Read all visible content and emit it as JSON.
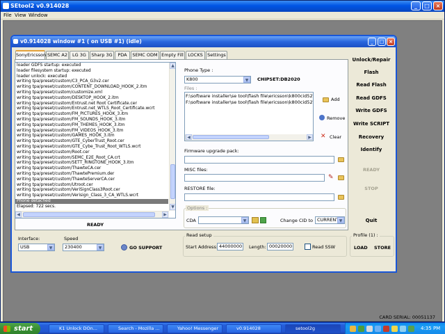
{
  "outer_window": {
    "title": "SEtool2 v0.914028"
  },
  "menubar": [
    "File",
    "View",
    "Window"
  ],
  "inner_window": {
    "title": "v0.914028 window #1 ( on USB #1) (idle)"
  },
  "tabs": [
    "SonyEricsson",
    "SEMC A2",
    "LG 3G",
    "Sharp 3G",
    "PDA",
    "SEMC ODM",
    "Empty Fill",
    "LOCKS",
    "Settings"
  ],
  "log": [
    "loader GDFS startup: executed",
    "loader filesystem startup: executed",
    "loader unlock: executed",
    "writing tpa/preset/custom/C3_PCA_G3v2.cer",
    "writing tpa/preset/custom/CONTENT_DOWNLOAD_HOOK_2.itm",
    "writing tpa/preset/custom/customize.xml",
    "writing tpa/preset/custom/DESKTOP_HOOK_2.itm",
    "writing tpa/preset/custom/Entrust.net Root Certificate.cer",
    "writing tpa/preset/custom/Entrust.net_WTLS_Root_Certificate.wcrt",
    "writing tpa/preset/custom/FM_PICTURES_HOOK_3.itm",
    "writing tpa/preset/custom/FM_SOUNDS_HOOK_3.itm",
    "writing tpa/preset/custom/FM_THEMES_HOOK_3.itm",
    "writing tpa/preset/custom/FM_VIDEOS_HOOK_3.itm",
    "writing tpa/preset/custom/GAMES_HOOK_3.itm",
    "writing tpa/preset/custom/GTE_CyberTrust_Root.cer",
    "writing tpa/preset/custom/GTE_Cybe_Trust_Root_WTLS.wcrt",
    "writing tpa/preset/custom/Root.cer",
    "writing tpa/preset/custom/SEMC_E2E_Root_CA.crt",
    "writing tpa/preset/custom/SETT_RINGTONE_HOOK_3.itm",
    "writing tpa/preset/custom/ThawteCA.cer",
    "writing tpa/preset/custom/ThawtePremium.der",
    "writing tpa/preset/custom/ThawteServerCA.cer",
    "writing tpa/preset/custom/Utroot.cer",
    "writing tpa/preset/custom/VeriSignClass3Root.cer",
    "writing tpa/preset/custom/Verisign_Class_3_CA_WTLS.wcrt",
    "Phone detached",
    "Elapsed: 722 secs."
  ],
  "status_left": "READY",
  "phone_type": {
    "label": "Phone Type :",
    "value": "K800",
    "chipset": "CHIPSET:DB2020"
  },
  "files": {
    "label": "Files :",
    "items": [
      "F:\\software installer\\se tool\\flash file\\ericsson\\k800cid52\\R1",
      "F:\\software installer\\se tool\\flash file\\ericsson\\k800cid52\\R1"
    ],
    "add": "Add",
    "remove": "Remove",
    "clear": "Clear"
  },
  "firmware": {
    "label": "Firmware upgrade pack:",
    "value": ""
  },
  "misc": {
    "label": "MISC files:",
    "value": ""
  },
  "restore": {
    "label": "RESTORE file:",
    "value": ""
  },
  "options": {
    "label": "Options :",
    "cda_label": "CDA",
    "cda_value": "",
    "change_cid_label": "Change CID to",
    "change_cid_value": "CURRENT"
  },
  "right_buttons": [
    "Unlock/Repair",
    "Flash",
    "Read Flash",
    "Read GDFS",
    "Write GDFS",
    "Write SCRIPT",
    "Recovery",
    "Identify",
    "READY",
    "STOP",
    "Quit"
  ],
  "interface": {
    "label": "Interface:",
    "value": "USB"
  },
  "speed": {
    "label": "Speed",
    "value": "230400"
  },
  "go_support": "GO SUPPORT",
  "read_setup": {
    "label": "Read setup",
    "start_label": "Start Address:",
    "start_value": "44000000",
    "length_label": "Length:",
    "length_value": "00020000",
    "ssw_label": "Read SSW"
  },
  "profile": {
    "label": "Profile (1) :",
    "load": "LOAD",
    "store": "STORE"
  },
  "card_serial": "CARD SERIAL: 00051137",
  "taskbar": {
    "start": "start",
    "tasks": [
      "K1 Unlock DOn...",
      "Search - Mozilla ...",
      "Yahoo! Messenger",
      "v0.914028",
      "setool2g"
    ],
    "clock": "4:35 PM"
  },
  "colors": {
    "title_blue": "#0055e5",
    "xp_face": "#ece9d8",
    "start_green": "#378f32",
    "tray_blue": "#1489e8"
  }
}
